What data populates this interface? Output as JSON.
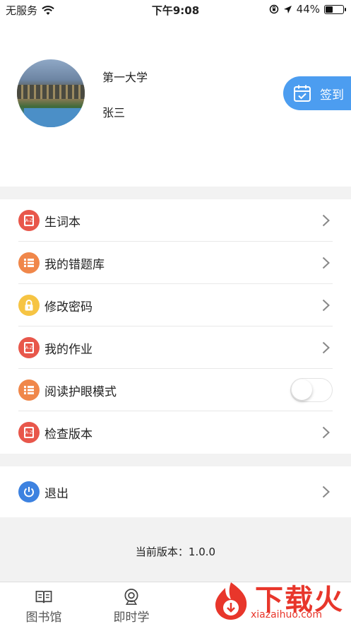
{
  "status_bar": {
    "carrier": "无服务",
    "time": "下午9:08",
    "battery_pct": "44%",
    "battery_level": 0.44
  },
  "profile": {
    "school": "第一大学",
    "name": "张三",
    "signin_label": "签到"
  },
  "menu": {
    "items": [
      {
        "label": "生词本",
        "icon": "dictionary-icon",
        "color": "#e8574b",
        "control": "chevron"
      },
      {
        "label": "我的错题库",
        "icon": "list-icon",
        "color": "#f0874a",
        "control": "chevron"
      },
      {
        "label": "修改密码",
        "icon": "lock-icon",
        "color": "#f6c443",
        "control": "chevron"
      },
      {
        "label": "我的作业",
        "icon": "dictionary-icon",
        "color": "#e8574b",
        "control": "chevron"
      },
      {
        "label": "阅读护眼模式",
        "icon": "list-icon",
        "color": "#f0874a",
        "control": "toggle",
        "toggle_on": false
      },
      {
        "label": "检查版本",
        "icon": "dictionary-icon",
        "color": "#e8574b",
        "control": "chevron"
      }
    ],
    "logout": {
      "label": "退出",
      "icon": "power-icon",
      "color": "#3d82e0"
    }
  },
  "version_text": "当前版本：1.0.0",
  "tabbar": {
    "tabs": [
      {
        "label": "图书馆",
        "icon": "book-icon"
      },
      {
        "label": "即时学",
        "icon": "webcam-icon"
      }
    ]
  },
  "watermark": {
    "title": "下载火",
    "subtitle": "xiazaihuo.com"
  }
}
